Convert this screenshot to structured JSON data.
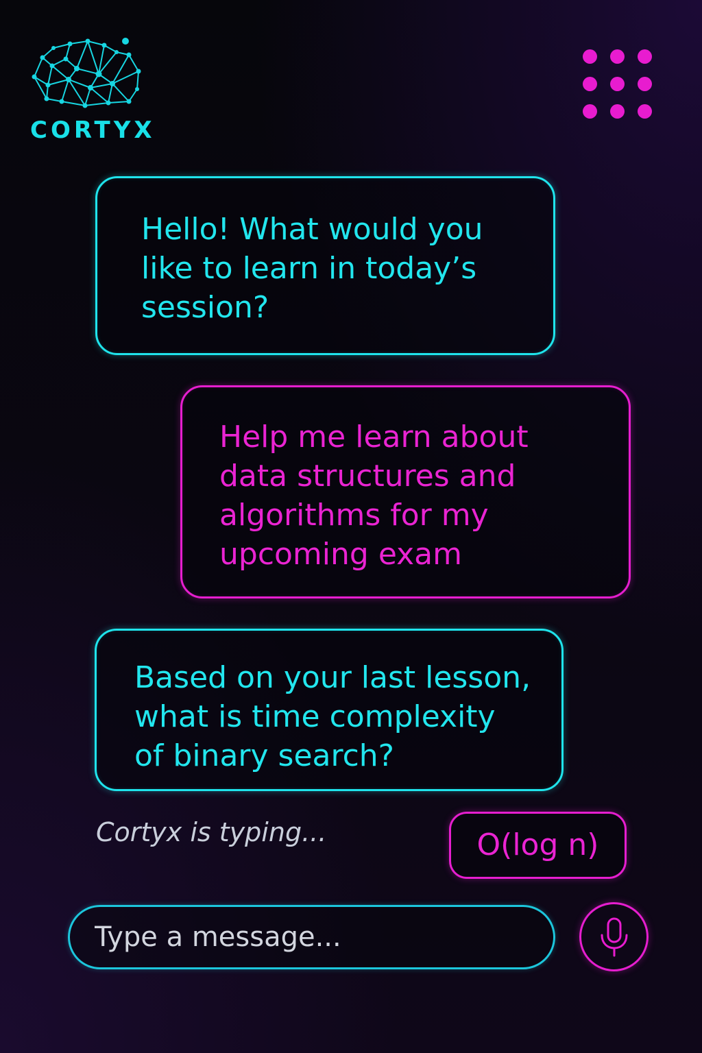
{
  "app": {
    "name": "CORTYX",
    "accent_cyan": "#1fe4ec",
    "accent_magenta": "#e61ecf"
  },
  "header": {
    "logo_icon": "brain-network-icon",
    "menu_icon": "grid-dots-icon"
  },
  "messages": [
    {
      "sender": "ai",
      "text": "Hello! What would you\nlike to learn in today’s\nsession?"
    },
    {
      "sender": "user",
      "text": "Help me learn about\ndata structures and\nalgorithms for my\nupcoming exam"
    },
    {
      "sender": "ai",
      "text": "Based on your last lesson,\nwhat is time complexity\nof binary search?"
    }
  ],
  "typing_indicator": "Cortyx is typing...",
  "suggested_reply": "O(log n)",
  "composer": {
    "placeholder": "Type a message...",
    "value": "",
    "mic_icon": "microphone-icon"
  }
}
